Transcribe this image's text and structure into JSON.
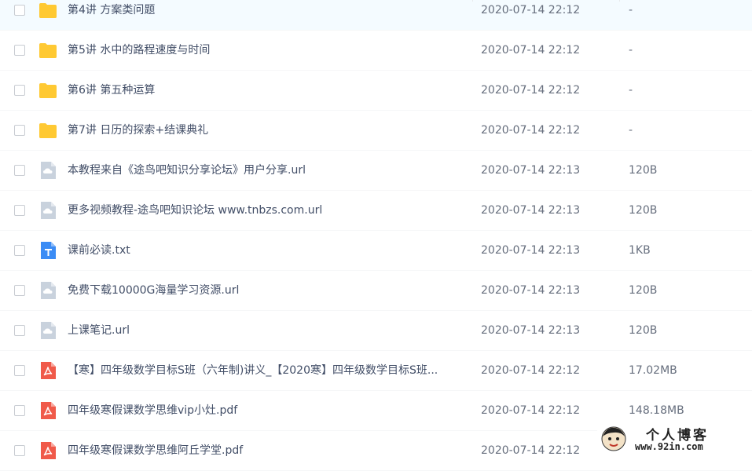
{
  "files": [
    {
      "type": "folder",
      "name": "第4讲 方案类问题",
      "date": "2020-07-14 22:12",
      "size": "-"
    },
    {
      "type": "folder",
      "name": "第5讲 水中的路程速度与时间",
      "date": "2020-07-14 22:12",
      "size": "-"
    },
    {
      "type": "folder",
      "name": "第6讲 第五种运算",
      "date": "2020-07-14 22:12",
      "size": "-"
    },
    {
      "type": "folder",
      "name": "第7讲 日历的探索+结课典礼",
      "date": "2020-07-14 22:12",
      "size": "-"
    },
    {
      "type": "url",
      "name": "本教程来自《途鸟吧知识分享论坛》用户分享.url",
      "date": "2020-07-14 22:13",
      "size": "120B"
    },
    {
      "type": "url",
      "name": "更多视频教程-途鸟吧知识论坛 www.tnbzs.com.url",
      "date": "2020-07-14 22:13",
      "size": "120B"
    },
    {
      "type": "txt",
      "name": "课前必读.txt",
      "date": "2020-07-14 22:13",
      "size": "1KB"
    },
    {
      "type": "url",
      "name": "免费下载10000G海量学习资源.url",
      "date": "2020-07-14 22:13",
      "size": "120B"
    },
    {
      "type": "url",
      "name": "上课笔记.url",
      "date": "2020-07-14 22:13",
      "size": "120B"
    },
    {
      "type": "pdf",
      "name": "【寒】四年级数学目标S班（六年制)讲义_【2020寒】四年级数学目标S班...",
      "date": "2020-07-14 22:12",
      "size": "17.02MB"
    },
    {
      "type": "pdf",
      "name": "四年级寒假课数学思维vip小灶.pdf",
      "date": "2020-07-14 22:12",
      "size": "148.18MB"
    },
    {
      "type": "pdf",
      "name": "四年级寒假课数学思维阿丘学堂.pdf",
      "date": "2020-07-14 22:12",
      "size": ""
    }
  ],
  "icons": {
    "folder": "folder-icon",
    "url": "link-file-icon",
    "txt": "text-file-icon",
    "pdf": "pdf-file-icon"
  },
  "colors": {
    "folder": "#ffc933",
    "url": "#c9d2dd",
    "txt": "#3b8cf5",
    "pdf": "#f05a4a"
  },
  "watermark": {
    "name": "个人博客",
    "url": "www.92in.com"
  }
}
